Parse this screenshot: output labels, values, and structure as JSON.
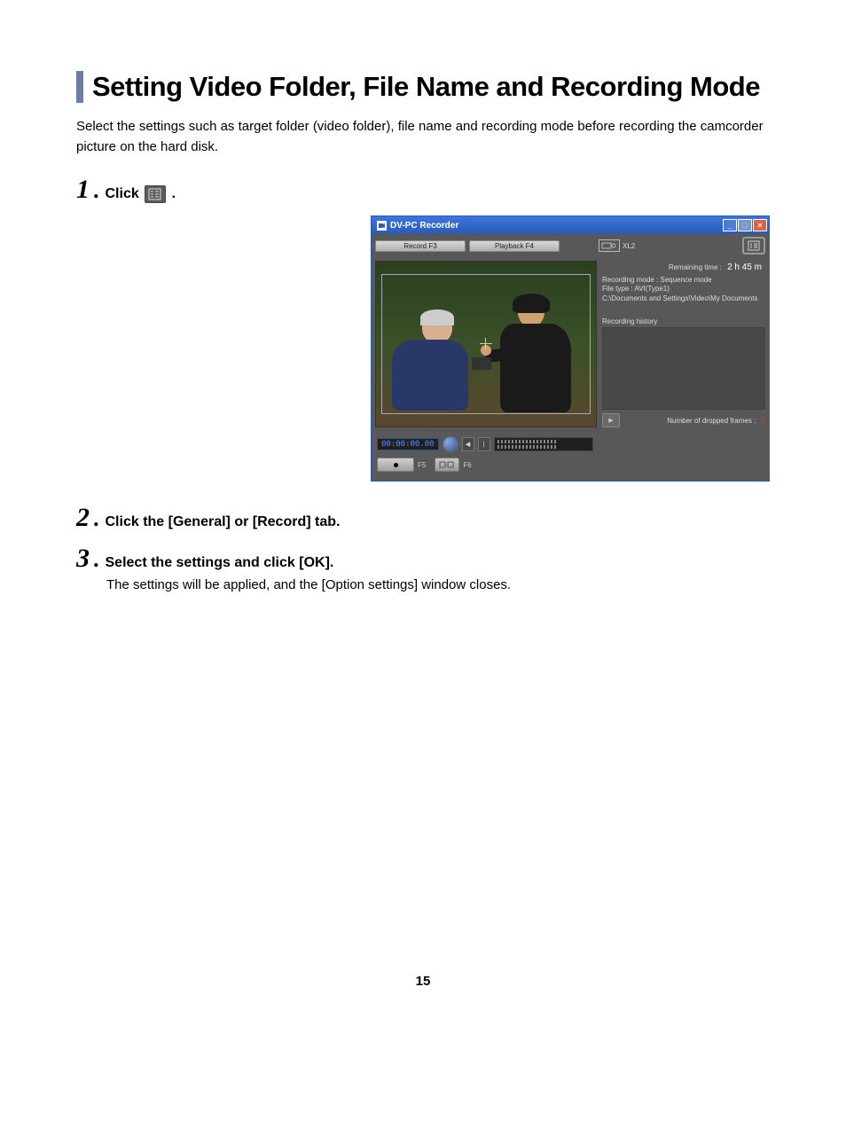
{
  "title": "Setting Video Folder, File Name and Recording Mode",
  "intro": "Select the settings such as target folder (video folder), file name and recording mode before recording the camcorder picture on the hard disk.",
  "steps": {
    "s1_num": "1",
    "s1_pre": "Click ",
    "s1_post": ".",
    "s2_num": "2",
    "s2_text": "Click the [General] or [Record] tab.",
    "s3_num": "3",
    "s3_text": "Select the settings and click [OK].",
    "s3_sub": "The settings will be applied, and the [Option settings] window closes."
  },
  "app": {
    "title": "DV-PC Recorder",
    "tab_record": "Record F3",
    "tab_playback": "Playback F4",
    "cam_model": "XL2",
    "remaining_label": "Remaining time :",
    "remaining_value": "2 h 45 m",
    "info1": "Recording mode : Sequence mode",
    "info2": "File type : AVI(Type1)",
    "info3": "C:\\Documents and Settings\\Video\\My Documents",
    "history_label": "Recording history",
    "dropped_label": "Number of dropped frames :",
    "dropped_value": "0",
    "timecode": "00:00:00.00",
    "f5": "F5",
    "f6": "F6"
  },
  "page_number": "15"
}
